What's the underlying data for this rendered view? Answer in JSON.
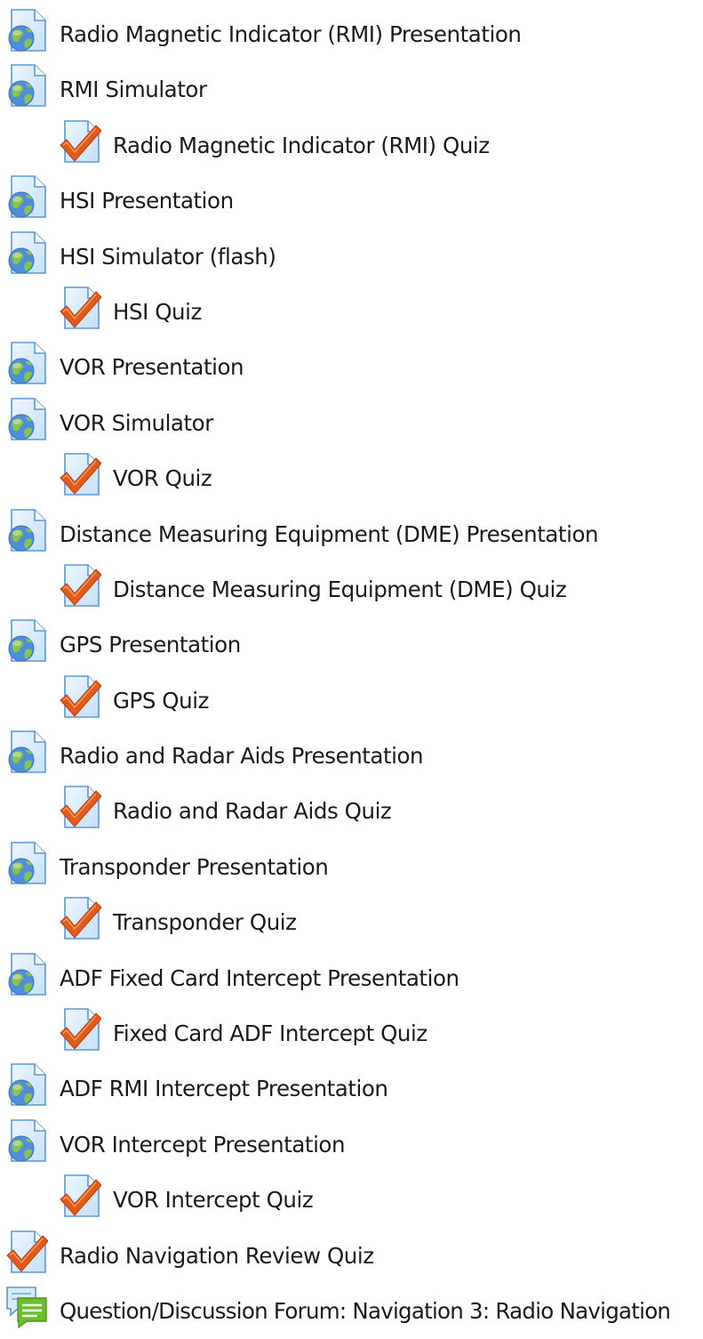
{
  "icon_colors": {
    "page": "#d9ecfb",
    "page_border": "#5b97d6",
    "globe_land": "#8bc34a",
    "globe_sea": "#4f8fd9",
    "check": "#e25a1c",
    "forum_bubble": "#6abf2a"
  },
  "activities": [
    {
      "type": "url",
      "icon": "globe-page-icon",
      "level": 0,
      "label": "Radio Magnetic Indicator (RMI) Presentation"
    },
    {
      "type": "url",
      "icon": "globe-page-icon",
      "level": 0,
      "label": "RMI Simulator"
    },
    {
      "type": "quiz",
      "icon": "quiz-check-icon",
      "level": 1,
      "label": "Radio Magnetic Indicator (RMI) Quiz"
    },
    {
      "type": "url",
      "icon": "globe-page-icon",
      "level": 0,
      "label": "HSI Presentation"
    },
    {
      "type": "url",
      "icon": "globe-page-icon",
      "level": 0,
      "label": "HSI Simulator (flash)"
    },
    {
      "type": "quiz",
      "icon": "quiz-check-icon",
      "level": 1,
      "label": "HSI Quiz"
    },
    {
      "type": "url",
      "icon": "globe-page-icon",
      "level": 0,
      "label": "VOR Presentation"
    },
    {
      "type": "url",
      "icon": "globe-page-icon",
      "level": 0,
      "label": "VOR Simulator"
    },
    {
      "type": "quiz",
      "icon": "quiz-check-icon",
      "level": 1,
      "label": "VOR Quiz"
    },
    {
      "type": "url",
      "icon": "globe-page-icon",
      "level": 0,
      "label": "Distance Measuring Equipment (DME) Presentation"
    },
    {
      "type": "quiz",
      "icon": "quiz-check-icon",
      "level": 1,
      "label": "Distance Measuring Equipment (DME) Quiz"
    },
    {
      "type": "url",
      "icon": "globe-page-icon",
      "level": 0,
      "label": "GPS Presentation"
    },
    {
      "type": "quiz",
      "icon": "quiz-check-icon",
      "level": 1,
      "label": "GPS Quiz"
    },
    {
      "type": "url",
      "icon": "globe-page-icon",
      "level": 0,
      "label": " Radio and Radar Aids Presentation"
    },
    {
      "type": "quiz",
      "icon": "quiz-check-icon",
      "level": 1,
      "label": "Radio and Radar Aids Quiz"
    },
    {
      "type": "url",
      "icon": "globe-page-icon",
      "level": 0,
      "label": "Transponder Presentation"
    },
    {
      "type": "quiz",
      "icon": "quiz-check-icon",
      "level": 1,
      "label": "Transponder Quiz"
    },
    {
      "type": "url",
      "icon": "globe-page-icon",
      "level": 0,
      "label": "ADF Fixed Card Intercept Presentation"
    },
    {
      "type": "quiz",
      "icon": "quiz-check-icon",
      "level": 1,
      "label": "Fixed Card ADF Intercept Quiz"
    },
    {
      "type": "url",
      "icon": "globe-page-icon",
      "level": 0,
      "label": "ADF RMI Intercept Presentation"
    },
    {
      "type": "url",
      "icon": "globe-page-icon",
      "level": 0,
      "label": "VOR Intercept Presentation"
    },
    {
      "type": "quiz",
      "icon": "quiz-check-icon",
      "level": 1,
      "label": "VOR Intercept Quiz"
    },
    {
      "type": "quiz",
      "icon": "quiz-check-icon",
      "level": 0,
      "label": "Radio Navigation Review Quiz"
    },
    {
      "type": "forum",
      "icon": "forum-speech-bubble-icon",
      "level": 0,
      "label": "Question/Discussion Forum: Navigation 3: Radio Navigation"
    }
  ]
}
